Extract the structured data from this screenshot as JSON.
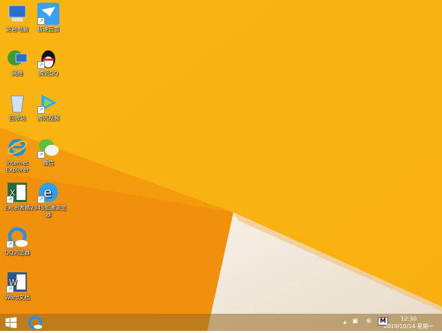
{
  "desktop": {
    "icons": [
      {
        "label": "这台电脑",
        "icon": "computer-icon"
      },
      {
        "label": "极速迅雷",
        "icon": "xunlei-icon"
      },
      {
        "label": "网络",
        "icon": "network-icon"
      },
      {
        "label": "腾讯QQ",
        "icon": "qq-penguin-icon"
      },
      {
        "label": "回收站",
        "icon": "recycle-bin-icon"
      },
      {
        "label": "腾讯视频",
        "icon": "tencent-video-icon"
      },
      {
        "label": "Internet Explorer",
        "icon": "ie-icon"
      },
      {
        "label": "微信",
        "icon": "wechat-icon"
      },
      {
        "label": "Excel表格",
        "icon": "excel-icon"
      },
      {
        "label": "2345加速浏览器",
        "icon": "browser-2345-icon"
      },
      {
        "label": "QQ浏览器",
        "icon": "qq-browser-icon"
      },
      {
        "label": "Word文档",
        "icon": "word-icon"
      }
    ],
    "colors": {
      "bg_top": "#f9b712",
      "bg_mid": "#f5a00e",
      "wedge": "#f1e9dd"
    }
  },
  "taskbar": {
    "start": "windows-logo-icon",
    "pinned": [
      "qq-browser-icon"
    ],
    "tray": {
      "chevron": "▲",
      "ime": "M"
    },
    "clock": {
      "time": "12:30",
      "date": "2019/10/14 星期一"
    }
  }
}
